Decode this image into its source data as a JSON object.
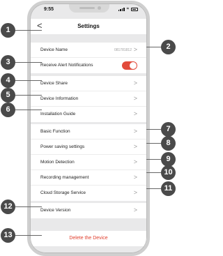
{
  "status": {
    "time": "9:55"
  },
  "nav": {
    "back": "<",
    "title": "Settings"
  },
  "rows": {
    "device_name": {
      "label": "Device Name",
      "value": "081781812"
    },
    "alert": {
      "label": "Receive Alert Notifications",
      "enabled": true
    },
    "share": {
      "label": "Device Share"
    },
    "info": {
      "label": "Device Information"
    },
    "guide": {
      "label": "Installation Guide"
    },
    "basic": {
      "label": "Basic Function"
    },
    "power": {
      "label": "Power saving settings"
    },
    "motion": {
      "label": "Motion Detection"
    },
    "recording": {
      "label": "Recording management"
    },
    "cloud": {
      "label": "Cloud Storage Service"
    },
    "version": {
      "label": "Device Version"
    },
    "delete": {
      "label": "Delete the Device"
    }
  },
  "chevron": ">",
  "callouts": [
    "1",
    "2",
    "3",
    "4",
    "5",
    "6",
    "7",
    "8",
    "9",
    "10",
    "11",
    "12",
    "13"
  ],
  "colors": {
    "accent": "#e24b3b",
    "badge": "#4a4a4a"
  }
}
